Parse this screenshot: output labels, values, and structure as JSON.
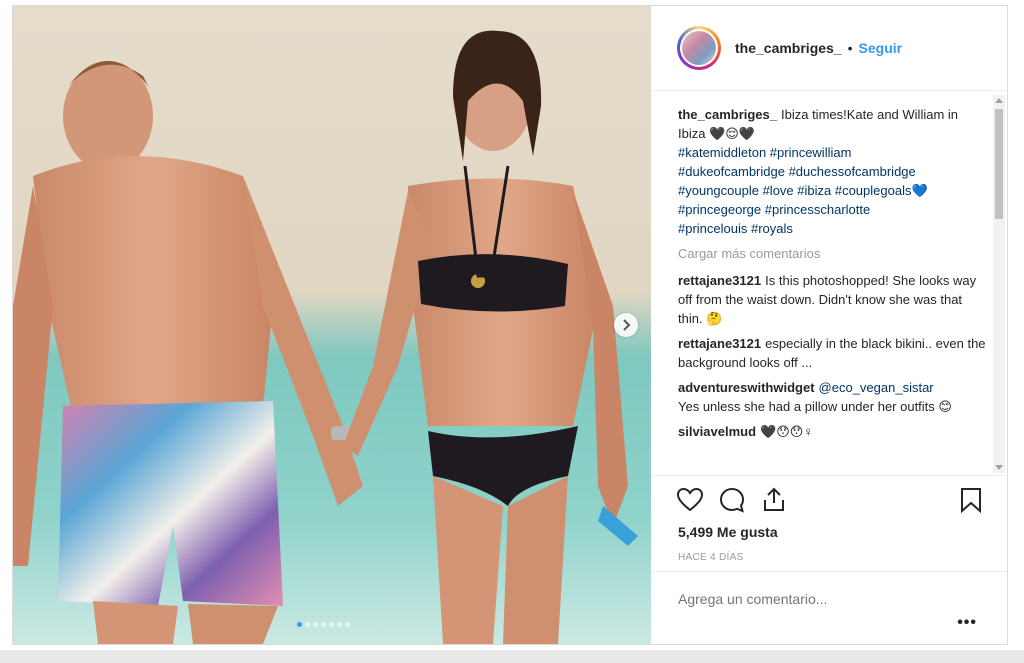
{
  "header": {
    "username": "the_cambriges_",
    "separator": "•",
    "follow_label": "Seguir"
  },
  "caption": {
    "username": "the_cambriges_",
    "text": "Ibiza times!Kate and William in Ibiza 🖤😌🖤",
    "hashtags_line1": "#katemiddleton #princewilliam",
    "hashtags_line2": "#dukeofcambridge #duchessofcambridge",
    "hashtags_line3": "#youngcouple #love #ibiza #couplegoals💙",
    "hashtags_line4": "#princegeorge #princesscharlotte",
    "hashtags_line5": "#princelouis #royals"
  },
  "load_more": "Cargar más comentarios",
  "comments": [
    {
      "user": "rettajane3121",
      "mention": "",
      "text": "Is this photoshopped! She looks way off from the waist down. Didn't know she was that thin. 🤔"
    },
    {
      "user": "rettajane3121",
      "mention": "",
      "text": "especially in the black bikini.. even the background looks off ..."
    },
    {
      "user": "adventureswithwidget",
      "mention": "@eco_vegan_sistar",
      "text": "Yes unless she had a pillow under her outfits 😊"
    },
    {
      "user": "silviavelmud",
      "mention": "",
      "text": "🖤😯😯♀"
    }
  ],
  "actions": {
    "likes": "5,499 Me gusta",
    "timestamp": "HACE 4 DÍAS"
  },
  "add_comment": {
    "placeholder": "Agrega un comentario...",
    "options": "•••"
  },
  "carousel": {
    "dot_count": 7,
    "active_index": 0
  },
  "colors": {
    "link": "#3897f0",
    "hashtag": "#003569",
    "text": "#262626",
    "muted": "#999999",
    "border": "#dbdbdb"
  },
  "icons": [
    "heart-icon",
    "comment-icon",
    "share-icon",
    "bookmark-icon",
    "chevron-right-icon"
  ]
}
